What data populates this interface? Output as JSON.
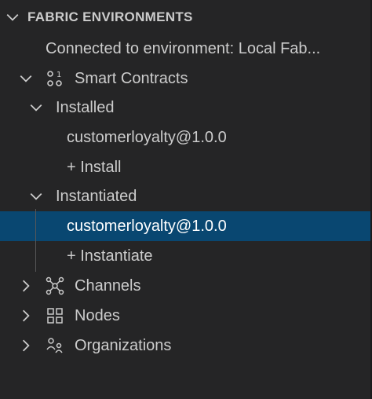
{
  "section": {
    "title": "FABRIC ENVIRONMENTS"
  },
  "tree": {
    "connection": "Connected to environment: Local Fab...",
    "smart_contracts": "Smart Contracts",
    "installed": "Installed",
    "installed_item": "customerloyalty@1.0.0",
    "install_action": "+ Install",
    "instantiated": "Instantiated",
    "instantiated_item": "customerloyalty@1.0.0",
    "instantiate_action": "+ Instantiate",
    "channels": "Channels",
    "nodes": "Nodes",
    "organizations": "Organizations"
  },
  "colors": {
    "background": "#252526",
    "selection": "#094771",
    "text": "#cccccc"
  }
}
